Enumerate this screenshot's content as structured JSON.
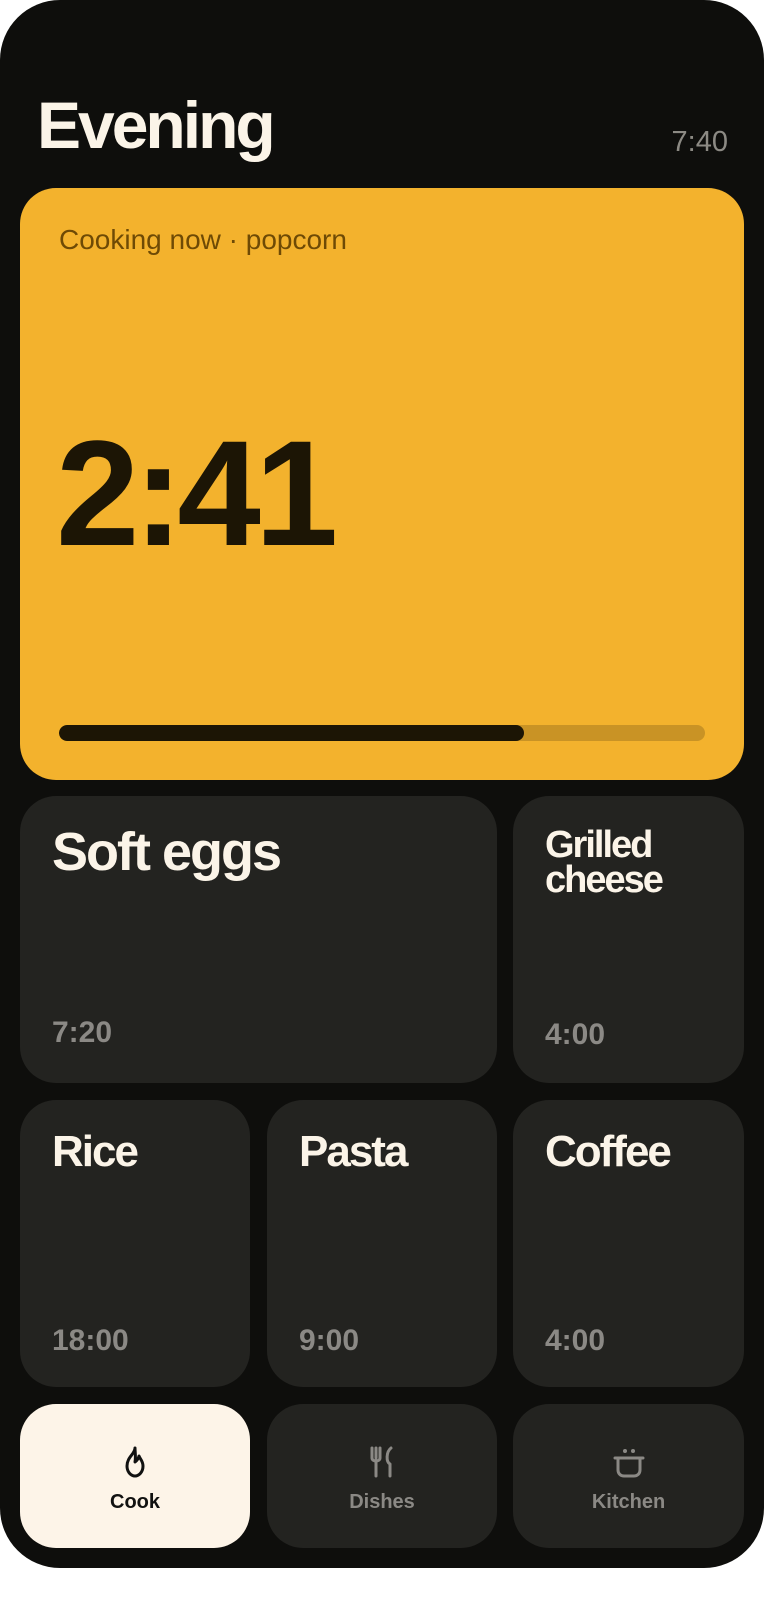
{
  "header": {
    "title": "Evening",
    "time": "7:40"
  },
  "hero": {
    "label": "Cooking now · popcorn",
    "timer": "2:41",
    "progress": 0.72,
    "color": "#f3b22d"
  },
  "tiles": [
    {
      "name": "Soft eggs",
      "time": "7:20"
    },
    {
      "name": "Grilled cheese",
      "time": "4:00"
    },
    {
      "name": "Rice",
      "time": "18:00"
    },
    {
      "name": "Pasta",
      "time": "9:00"
    },
    {
      "name": "Coffee",
      "time": "4:00"
    }
  ],
  "nav": [
    {
      "label": "Cook",
      "icon": "flame-icon",
      "active": true
    },
    {
      "label": "Dishes",
      "icon": "utensils-icon",
      "active": false
    },
    {
      "label": "Kitchen",
      "icon": "pot-icon",
      "active": false
    }
  ]
}
